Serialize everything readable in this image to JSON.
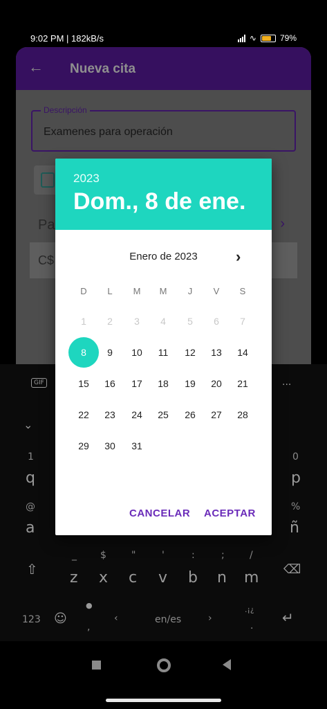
{
  "status_bar": {
    "time_text": "9:02 PM | 182kB/s",
    "battery_text": "79",
    "battery_level": 0.79
  },
  "app": {
    "title": "Nueva cita",
    "description_label": "Descripción",
    "description_value": "Examenes para operación",
    "behind_text_pa": "Pa",
    "behind_text_cs": "C$",
    "accent_color": "#6a2bb9"
  },
  "date_picker": {
    "year": "2023",
    "selected_date_text": "Dom., 8 de ene.",
    "month_label": "Enero de 2023",
    "weekdays": [
      "D",
      "L",
      "M",
      "M",
      "J",
      "V",
      "S"
    ],
    "weeks": [
      [
        "1",
        "2",
        "3",
        "4",
        "5",
        "6",
        "7"
      ],
      [
        "8",
        "9",
        "10",
        "11",
        "12",
        "13",
        "14"
      ],
      [
        "15",
        "16",
        "17",
        "18",
        "19",
        "20",
        "21"
      ],
      [
        "22",
        "23",
        "24",
        "25",
        "26",
        "27",
        "28"
      ],
      [
        "29",
        "30",
        "31"
      ]
    ],
    "selected_day": "8",
    "cancel_label": "CANCELAR",
    "accept_label": "ACEPTAR",
    "header_color": "#1ed6bf"
  },
  "keyboard": {
    "gif_label": "GIF",
    "more_label": "...",
    "row_numbers": [
      "1",
      "0"
    ],
    "row1_keys": [
      "q",
      "p"
    ],
    "row2_symbols": [
      "@",
      "%"
    ],
    "row2_keys": [
      "a",
      "ñ"
    ],
    "row3_symbols": [
      "_",
      "$",
      "\"",
      "'",
      ":",
      ";",
      "/"
    ],
    "row3_keys": [
      "z",
      "x",
      "c",
      "v",
      "b",
      "n",
      "m"
    ],
    "numbers_key": "123",
    "language_key": "en/es",
    "punct_key": ".¡¿"
  }
}
